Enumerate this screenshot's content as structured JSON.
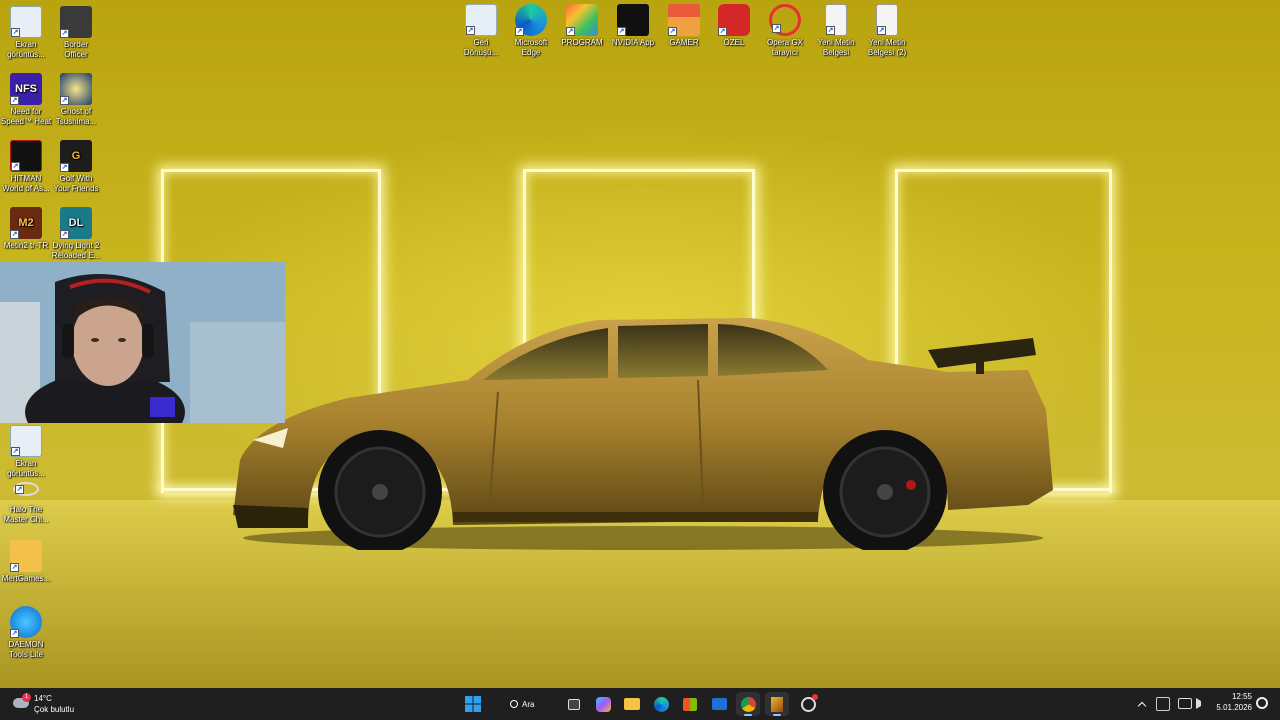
{
  "desktop": {
    "left_icons": [
      {
        "name": "ekran-goruntusu-1",
        "label_lines": [
          "Ekran",
          "görüntüs..."
        ],
        "icon": "screenshot-icon"
      },
      {
        "name": "border-officer",
        "label_lines": [
          "Border",
          "Officer"
        ],
        "icon": "border-officer-icon"
      },
      {
        "name": "need-for-speed-heat",
        "label_lines": [
          "Need for",
          "Speed™ Heat"
        ],
        "icon": "nfs-icon",
        "badge": "NFS"
      },
      {
        "name": "ghost-of-tsushima",
        "label_lines": [
          "Ghost of",
          "Tsushima..."
        ],
        "icon": "ghost-of-tsushima-icon"
      },
      {
        "name": "hitman",
        "label_lines": [
          "HITMAN",
          "World of As..."
        ],
        "icon": "hitman-icon"
      },
      {
        "name": "golf-with-your-friends",
        "label_lines": [
          "Golf With",
          "Your Friends"
        ],
        "icon": "golf-icon",
        "badge": "G"
      },
      {
        "name": "metin2",
        "label_lines": [
          "Metin2 tr-TR"
        ],
        "icon": "metin2-icon",
        "badge": "M2"
      },
      {
        "name": "dying-light-2",
        "label_lines": [
          "Dying Light 2",
          "Reloaded E..."
        ],
        "icon": "dying-light-icon",
        "badge": "DL"
      },
      {
        "name": "ekran-goruntusu-2",
        "label_lines": [
          "Ekran",
          "görüntüs..."
        ],
        "icon": "screenshot-icon"
      },
      {
        "name": "halo",
        "label_lines": [
          "Halo The",
          "Master Chi..."
        ],
        "icon": "halo-icon"
      },
      {
        "name": "mertgames",
        "label_lines": [
          "MertGames..."
        ],
        "icon": "folder-icon"
      },
      {
        "name": "daemon-tools",
        "label_lines": [
          "DAEMON",
          "Tools Lite"
        ],
        "icon": "daemon-tools-icon"
      }
    ],
    "top_icons": [
      {
        "name": "recycle-bin",
        "label_lines": [
          "Geri",
          "Dönüşü..."
        ],
        "icon": "recycle-bin-icon"
      },
      {
        "name": "microsoft-edge",
        "label_lines": [
          "Microsoft",
          "Edge"
        ],
        "icon": "edge-icon"
      },
      {
        "name": "program-folder",
        "label_lines": [
          "PROGRAM"
        ],
        "icon": "program-folder-icon"
      },
      {
        "name": "nvidia-app",
        "label_lines": [
          "NVIDIA App"
        ],
        "icon": "nvidia-icon"
      },
      {
        "name": "gamer-folder",
        "label_lines": [
          "GAMER"
        ],
        "icon": "gamer-home-icon"
      },
      {
        "name": "ozel",
        "label_lines": [
          "ÖZEL"
        ],
        "icon": "power-icon"
      },
      {
        "name": "opera-gx",
        "label_lines": [
          "Opera GX",
          "tarayıcı"
        ],
        "icon": "opera-gx-icon"
      },
      {
        "name": "yeni-metin-belgesi",
        "label_lines": [
          "Yeni Metin",
          "Belgesi"
        ],
        "icon": "text-document-icon"
      },
      {
        "name": "yeni-metin-belgesi-2",
        "label_lines": [
          "Yeni Metin",
          "Belgesi (2)"
        ],
        "icon": "text-document-icon"
      }
    ]
  },
  "taskbar": {
    "weather": {
      "temp": "14°C",
      "condition": "Çok bulutlu",
      "badge": "1"
    },
    "search_label": "Ara",
    "pinned": [
      {
        "name": "start-button",
        "icon": "windows-icon"
      },
      {
        "name": "search-button",
        "icon": "search-icon"
      },
      {
        "name": "task-view-button",
        "icon": "task-view-icon"
      },
      {
        "name": "copilot-button",
        "icon": "copilot-icon"
      },
      {
        "name": "file-explorer-button",
        "icon": "folder-icon"
      },
      {
        "name": "edge-taskbar-button",
        "icon": "edge-icon"
      },
      {
        "name": "store-button",
        "icon": "store-icon"
      },
      {
        "name": "outlook-button",
        "icon": "mail-icon"
      },
      {
        "name": "chrome-button",
        "icon": "chrome-icon"
      },
      {
        "name": "app-button",
        "icon": "app-icon"
      },
      {
        "name": "steam-like-button",
        "icon": "gear-app-icon"
      }
    ],
    "tray": {
      "time": "12:55",
      "date": "5.01.2026"
    }
  },
  "colors": {
    "taskbar_bg": "#1f1f1f",
    "wallpaper_yellow": "#c9b51e",
    "neon": "#fffbd0",
    "accent": "#8fc8ff"
  }
}
